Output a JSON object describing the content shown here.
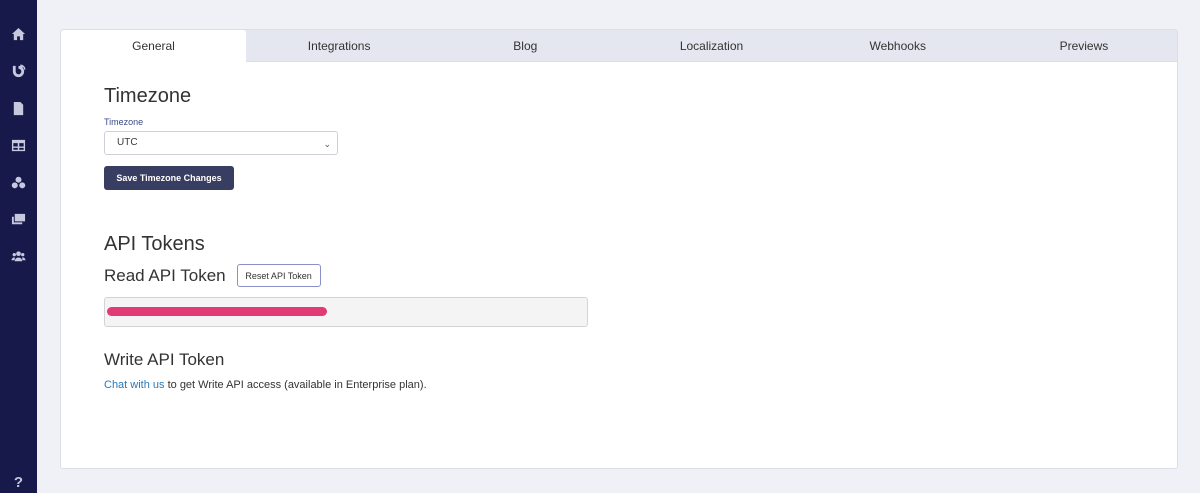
{
  "sidebar": {
    "icons": [
      {
        "name": "home-icon"
      },
      {
        "name": "blog-icon"
      },
      {
        "name": "document-icon"
      },
      {
        "name": "layout-icon"
      },
      {
        "name": "components-icon"
      },
      {
        "name": "media-icon"
      },
      {
        "name": "users-icon"
      }
    ],
    "help_label": "?"
  },
  "tabs": [
    {
      "label": "General",
      "active": true
    },
    {
      "label": "Integrations"
    },
    {
      "label": "Blog"
    },
    {
      "label": "Localization"
    },
    {
      "label": "Webhooks"
    },
    {
      "label": "Previews"
    }
  ],
  "timezone": {
    "title": "Timezone",
    "field_label": "Timezone",
    "selected": "UTC",
    "save_label": "Save Timezone Changes"
  },
  "api_tokens": {
    "title": "API Tokens",
    "read_title": "Read API Token",
    "reset_label": "Reset API Token",
    "write_title": "Write API Token",
    "chat_link": "Chat with us",
    "write_text": " to get Write API access (available in Enterprise plan)."
  },
  "colors": {
    "sidebar": "#16194a",
    "primary_button": "#383d62",
    "link": "#2a7ab8",
    "redaction": "#e23a74"
  }
}
